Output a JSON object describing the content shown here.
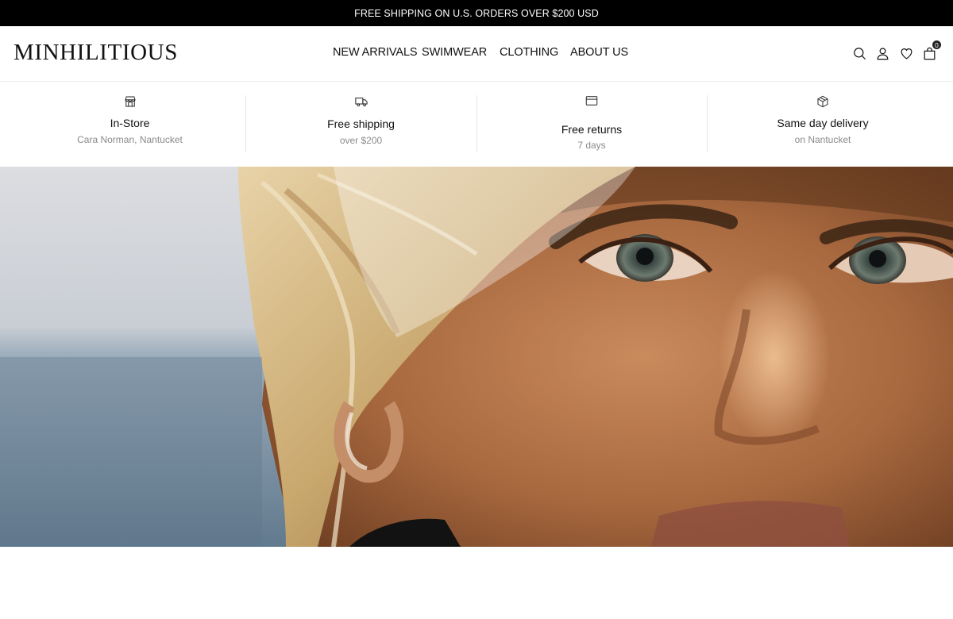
{
  "announcement": "FREE SHIPPING ON U.S. ORDERS OVER $200 USD",
  "header": {
    "logo": "MINHILITIOUS",
    "nav": [
      "NEW ARRIVALS",
      "SWIMWEAR",
      "CLOTHING",
      "ABOUT US"
    ],
    "icons": [
      "search-icon",
      "account-icon",
      "wishlist-heart-icon",
      "cart-bag-icon"
    ],
    "cart_count": "0"
  },
  "features": [
    {
      "icon": "store-icon",
      "title": "In-Store",
      "subtitle": "Cara Norman, Nantucket"
    },
    {
      "icon": "truck-icon",
      "title": "Free shipping",
      "subtitle": "over $200"
    },
    {
      "icon": "card-icon",
      "title": "Free returns",
      "subtitle": "7 days"
    },
    {
      "icon": "box-icon",
      "title": "Same day delivery",
      "subtitle": "on Nantucket"
    }
  ],
  "colors": {
    "announcement_bg": "#000000",
    "text": "#111111",
    "muted": "#8a8a8a"
  }
}
